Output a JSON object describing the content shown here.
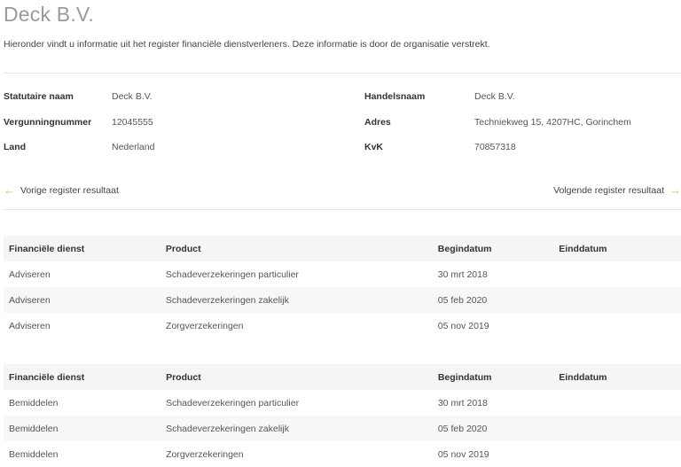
{
  "page": {
    "title": "Deck B.V.",
    "intro": "Hieronder vindt u informatie uit het register financiële dienstverleners. Deze informatie is door de organisatie verstrekt."
  },
  "info": {
    "statutaire_naam_label": "Statutaire naam",
    "statutaire_naam": "Deck B.V.",
    "vergunningnummer_label": "Vergunningnummer",
    "vergunningnummer": "12045555",
    "land_label": "Land",
    "land": "Nederland",
    "handelsnaam_label": "Handelsnaam",
    "handelsnaam": "Deck B.V.",
    "adres_label": "Adres",
    "adres": "Techniekweg 15, 4207HC, Gorinchem",
    "kvk_label": "KvK",
    "kvk": "70857318"
  },
  "nav": {
    "prev_label": "Vorige register resultaat",
    "next_label": "Volgende register resultaat",
    "arrow_color": "#e0b34a"
  },
  "tables": [
    {
      "headers": [
        "Financiële dienst",
        "Product",
        "Begindatum",
        "Einddatum"
      ],
      "rows": [
        [
          "Adviseren",
          "Schadeverzekeringen particulier",
          "30 mrt 2018",
          ""
        ],
        [
          "Adviseren",
          "Schadeverzekeringen zakelijk",
          "05 feb 2020",
          ""
        ],
        [
          "Adviseren",
          "Zorgverzekeringen",
          "05 nov 2019",
          ""
        ]
      ]
    },
    {
      "headers": [
        "Financiële dienst",
        "Product",
        "Begindatum",
        "Einddatum"
      ],
      "rows": [
        [
          "Bemiddelen",
          "Schadeverzekeringen particulier",
          "30 mrt 2018",
          ""
        ],
        [
          "Bemiddelen",
          "Schadeverzekeringen zakelijk",
          "05 feb 2020",
          ""
        ],
        [
          "Bemiddelen",
          "Zorgverzekeringen",
          "05 nov 2019",
          ""
        ]
      ]
    }
  ]
}
